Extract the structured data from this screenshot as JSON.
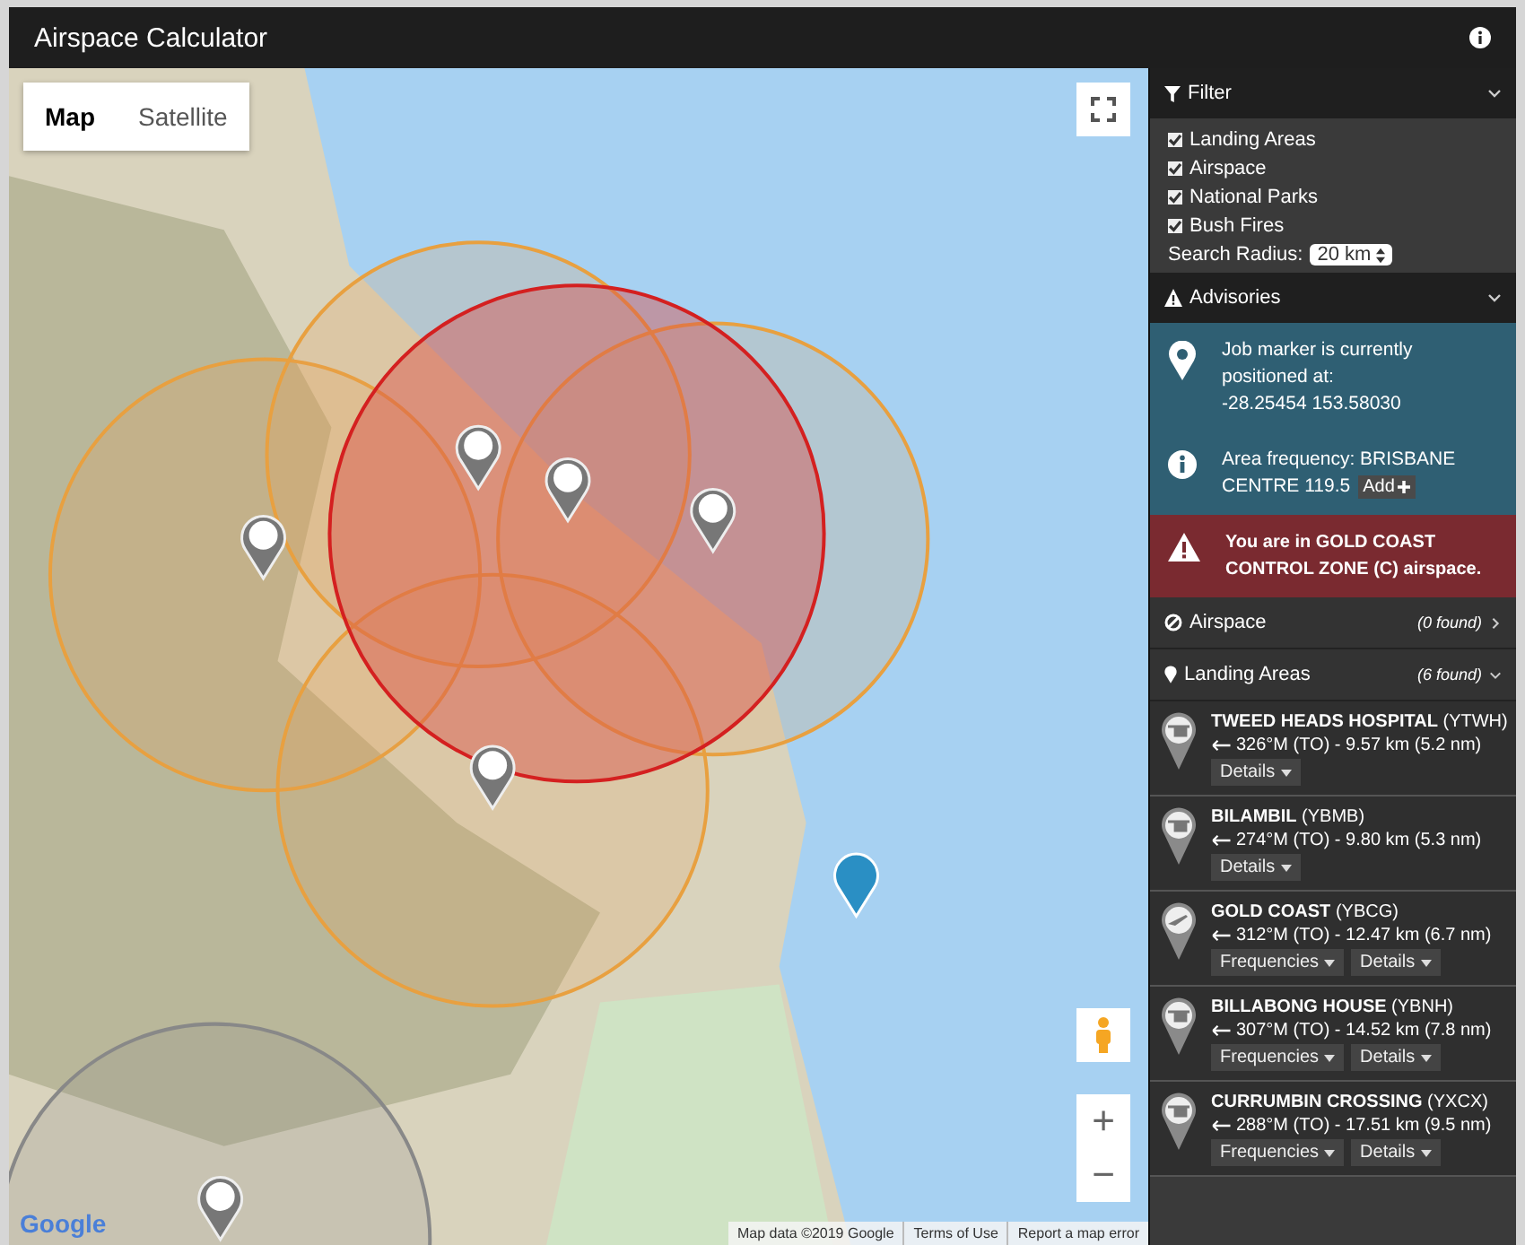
{
  "window": {
    "title": "Airspace Calculator"
  },
  "map": {
    "types": [
      {
        "label": "Map",
        "selected": true
      },
      {
        "label": "Satellite",
        "selected": false
      }
    ],
    "zoom_in": "+",
    "zoom_out": "−",
    "attribution": {
      "logo": "Google",
      "items": [
        "Map data ©2019 Google",
        "Terms of Use",
        "Report a map error"
      ]
    }
  },
  "sidebar": {
    "filter": {
      "title": "Filter",
      "expanded": true,
      "options": [
        {
          "label": "Landing Areas",
          "checked": true
        },
        {
          "label": "Airspace",
          "checked": true
        },
        {
          "label": "National Parks",
          "checked": true
        },
        {
          "label": "Bush Fires",
          "checked": true
        }
      ],
      "search_radius": {
        "label": "Search Radius:",
        "value": "20 km"
      }
    },
    "advisories": {
      "title": "Advisories",
      "expanded": true,
      "items": [
        {
          "kind": "location",
          "lines": [
            "Job marker is currently positioned at:",
            "-28.25454 153.58030"
          ]
        },
        {
          "kind": "info",
          "lines": [
            "Area frequency: BRISBANE CENTRE 119.5"
          ],
          "button": "Add"
        },
        {
          "kind": "warning",
          "lines": [
            "You are in GOLD COAST CONTROL ZONE (C) airspace."
          ]
        }
      ]
    },
    "airspace": {
      "title": "Airspace",
      "count": "(0 found)",
      "expanded": false
    },
    "landing_areas": {
      "title": "Landing Areas",
      "count": "(6 found)",
      "expanded": true,
      "items": [
        {
          "kind": "helicopter",
          "name": "TWEED HEADS HOSPITAL",
          "code": "(YTWH)",
          "bearing": "326°M (TO) - 9.57 km (5.2 nm)",
          "buttons": [
            "Details"
          ]
        },
        {
          "kind": "helicopter",
          "name": "BILAMBIL",
          "code": "(YBMB)",
          "bearing": "274°M (TO) - 9.80 km (5.3 nm)",
          "buttons": [
            "Details"
          ]
        },
        {
          "kind": "airport",
          "name": "GOLD COAST",
          "code": "(YBCG)",
          "bearing": "312°M (TO) - 12.47 km (6.7 nm)",
          "buttons": [
            "Frequencies",
            "Details"
          ]
        },
        {
          "kind": "helicopter",
          "name": "BILLABONG HOUSE",
          "code": "(YBNH)",
          "bearing": "307°M (TO) - 14.52 km (7.8 nm)",
          "buttons": [
            "Frequencies",
            "Details"
          ]
        },
        {
          "kind": "helicopter",
          "name": "CURRUMBIN CROSSING",
          "code": "(YXCX)",
          "bearing": "288°M (TO) - 17.51 km (9.5 nm)",
          "buttons": [
            "Frequencies",
            "Details"
          ]
        }
      ]
    }
  }
}
